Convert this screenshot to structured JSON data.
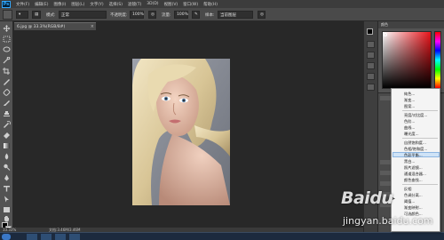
{
  "app": {
    "logo": "Ps"
  },
  "menu": {
    "items": [
      "文件(F)",
      "编辑(E)",
      "图像(I)",
      "图层(L)",
      "文字(Y)",
      "选择(S)",
      "滤镜(T)",
      "3D(D)",
      "视图(V)",
      "窗口(W)",
      "帮助(H)"
    ]
  },
  "options": {
    "mode_label": "模式:",
    "mode_value": "正常",
    "opacity_label": "不透明度:",
    "opacity_value": "100%",
    "flow_label": "流量:",
    "flow_value": "100%",
    "sample_label": "样本:",
    "sample_value": "当前图层"
  },
  "document": {
    "tab_title": "6.jpg @ 33.3%(RGB/8#)",
    "close": "×"
  },
  "status": {
    "zoom": "33.33%",
    "doc_info": "文档:3.46M/3.46M"
  },
  "color_panel": {
    "tab": "颜色"
  },
  "context_menu": {
    "items": [
      "纯色...",
      "渐变...",
      "图案...",
      "亮度/对比度...",
      "色阶...",
      "曲线...",
      "曝光度...",
      "自然饱和度...",
      "色相/饱和度...",
      "色彩平衡...",
      "黑白...",
      "照片滤镜...",
      "通道混合器...",
      "颜色查找...",
      "反相",
      "色调分离...",
      "阈值...",
      "渐变映射...",
      "可选颜色..."
    ],
    "highlighted": "色彩平衡..."
  },
  "watermark": {
    "logo": "Baidu",
    "url": "jingyan.baidu.com"
  },
  "colors": {
    "accent": "#31a8ff",
    "picker_hue": "#e8141a",
    "menu_bg": "#f4f4f4"
  }
}
